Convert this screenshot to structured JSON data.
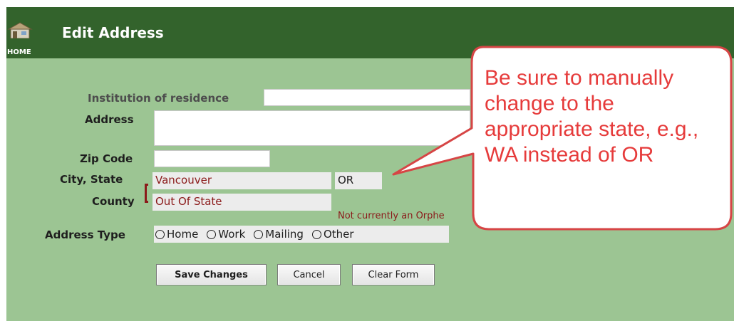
{
  "header": {
    "home_label": "HOME",
    "title": "Edit Address"
  },
  "form": {
    "institution_label": "Institution of residence",
    "address_label": "Address",
    "zip_label": "Zip Code",
    "city_state_label": "City, State",
    "county_label": "County",
    "address_type_label": "Address Type",
    "city_value": "Vancouver",
    "state_value": "OR",
    "county_value": "Out Of State",
    "orphan_note": "Not currently an Orphe",
    "address_types": [
      "Home",
      "Work",
      "Mailing",
      "Other"
    ]
  },
  "buttons": {
    "save": "Save Changes",
    "cancel": "Cancel",
    "clear": "Clear Form"
  },
  "callout": {
    "text": "Be sure to manually change to the appropriate state, e.g., WA instead of OR"
  },
  "colors": {
    "header_bg": "#33632c",
    "panel_bg": "#9cc593",
    "callout_border": "#d64545",
    "callout_text": "#e63b3b",
    "value_text": "#8b1a1a"
  },
  "icons": {
    "home": "house-icon"
  }
}
